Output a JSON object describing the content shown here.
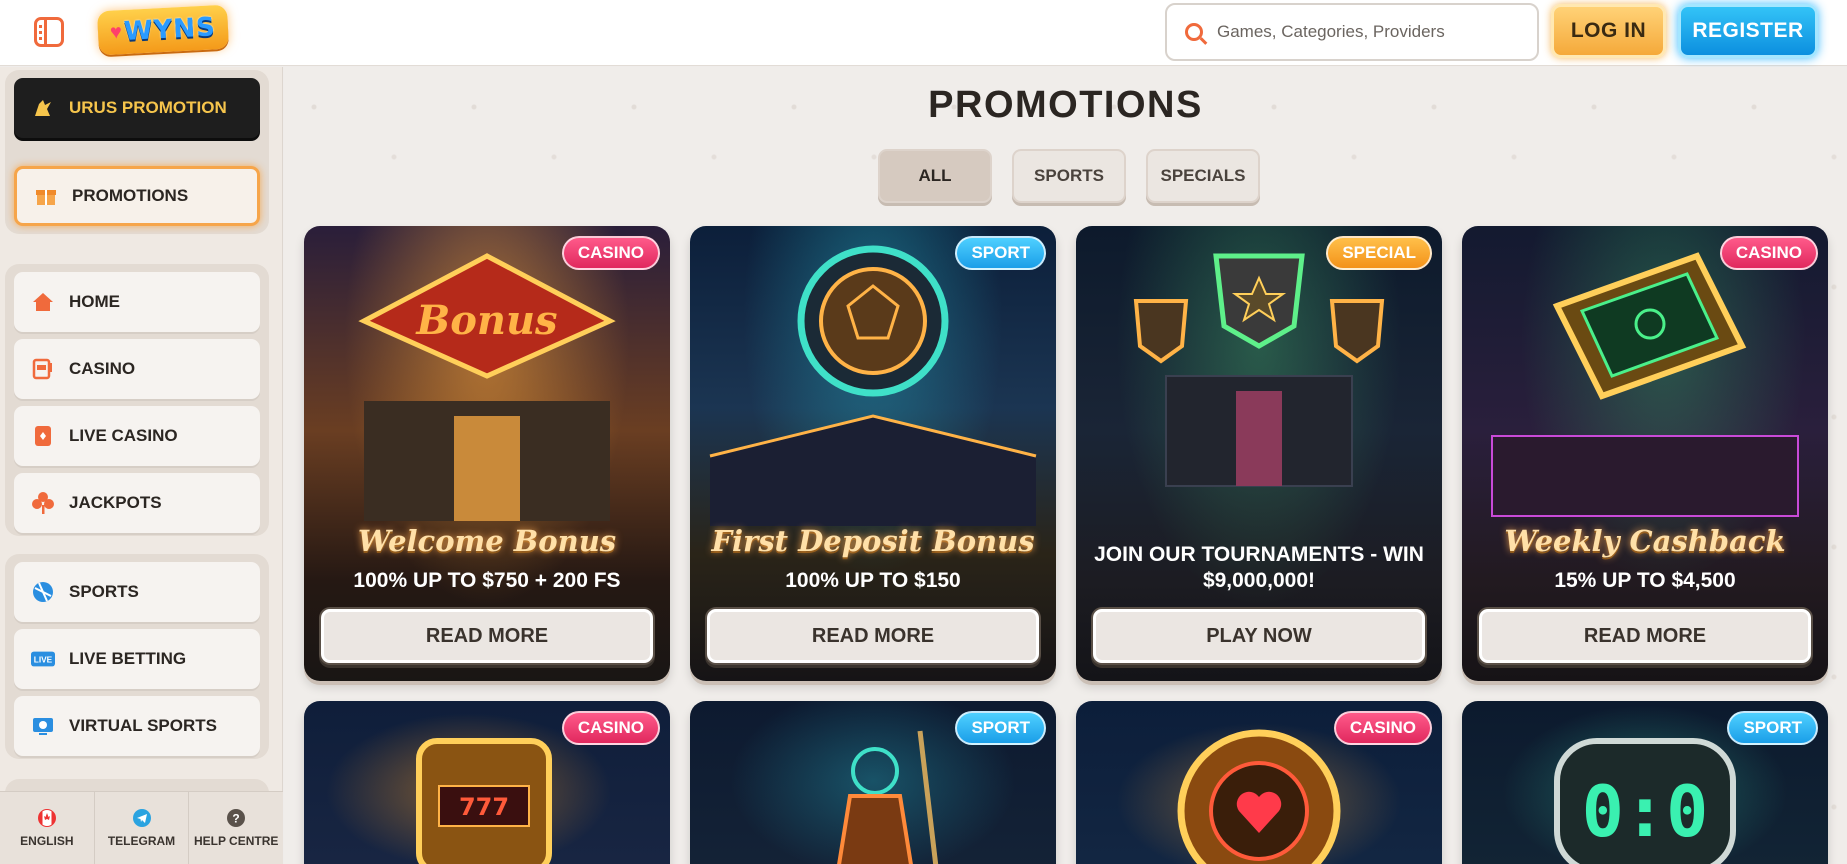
{
  "header": {
    "logo_text": "WYNS",
    "search_placeholder": "Games, Categories, Providers",
    "login_label": "LOG IN",
    "register_label": "REGISTER"
  },
  "sidebar": {
    "promo_items": [
      {
        "label": "URUS PROMOTION",
        "icon": "bull-icon"
      },
      {
        "label": "PROMOTIONS",
        "icon": "gift-icon"
      }
    ],
    "nav_items": [
      {
        "label": "HOME",
        "icon": "home-icon"
      },
      {
        "label": "CASINO",
        "icon": "slot-machine-icon"
      },
      {
        "label": "LIVE CASINO",
        "icon": "card-icon"
      },
      {
        "label": "JACKPOTS",
        "icon": "clover-icon"
      }
    ],
    "sport_items": [
      {
        "label": "SPORTS",
        "icon": "ball-icon"
      },
      {
        "label": "LIVE BETTING",
        "icon": "live-icon"
      },
      {
        "label": "VIRTUAL SPORTS",
        "icon": "virtual-icon"
      }
    ],
    "footer": [
      {
        "label": "ENGLISH",
        "icon": "canada-flag-icon"
      },
      {
        "label": "TELEGRAM",
        "icon": "telegram-icon"
      },
      {
        "label": "HELP CENTRE",
        "icon": "help-icon"
      }
    ]
  },
  "main": {
    "title": "PROMOTIONS",
    "tabs": [
      {
        "label": "ALL",
        "active": true
      },
      {
        "label": "SPORTS",
        "active": false
      },
      {
        "label": "SPECIALS",
        "active": false
      }
    ],
    "cards": [
      {
        "badge": "CASINO",
        "title": "Welcome Bonus",
        "subtitle": "100% UP TO $750 + 200 FS",
        "button": "READ MORE"
      },
      {
        "badge": "SPORT",
        "title": "First Deposit Bonus",
        "subtitle": "100% UP TO $150",
        "button": "READ MORE"
      },
      {
        "badge": "SPECIAL",
        "title": "",
        "subtitle": "JOIN OUR TOURNAMENTS - WIN $9,000,000!",
        "button": "PLAY NOW"
      },
      {
        "badge": "CASINO",
        "title": "Weekly Cashback",
        "subtitle": "15% UP TO $4,500",
        "button": "READ MORE"
      },
      {
        "badge": "CASINO"
      },
      {
        "badge": "SPORT"
      },
      {
        "badge": "CASINO"
      },
      {
        "badge": "SPORT"
      }
    ]
  },
  "colors": {
    "accent_orange": "#f06a3c",
    "login_gold": "#f5a93a",
    "register_blue": "#0c8fdf",
    "badge_casino": "#e1285e",
    "badge_sport": "#1a9ee8",
    "badge_special": "#f39219"
  }
}
